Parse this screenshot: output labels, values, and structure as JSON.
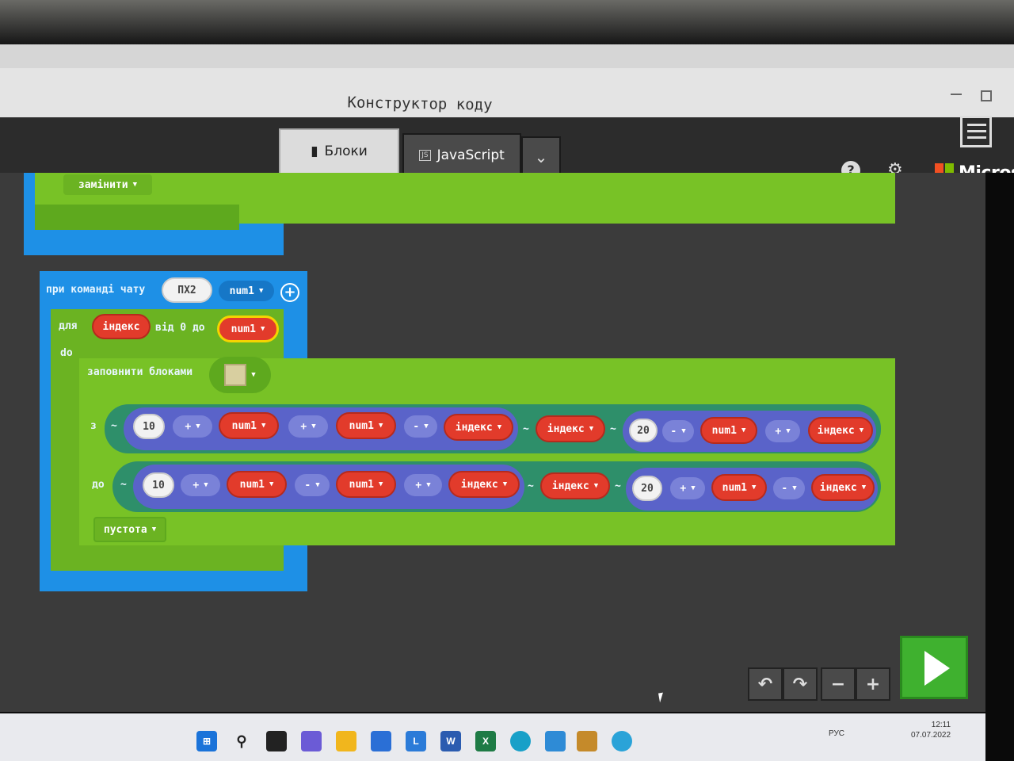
{
  "window": {
    "title": "Конструктор коду"
  },
  "tabs": {
    "blocks_label": "Блоки",
    "js_label": "JavaScript",
    "js_badge": "JS"
  },
  "brand": {
    "name": "Microso"
  },
  "blocks": {
    "top": {
      "replace_label": "замінити"
    },
    "chat": {
      "prefix": "при команді чату",
      "command": "ПХ2",
      "param": "num1"
    },
    "for_loop": {
      "for_label": "для",
      "var": "індекс",
      "range_label": "від 0 до",
      "limit": "num1",
      "do_label": "do"
    },
    "fill": {
      "label": "заповнити блоками",
      "from_label": "з",
      "to_label": "до",
      "mode": "пустота"
    },
    "from_row": {
      "start": "10",
      "op1": "+",
      "v1": "num1",
      "op2": "+",
      "v2": "num1",
      "op3": "-",
      "v3": "індекс",
      "y": "індекс",
      "z_num": "20",
      "zop1": "-",
      "z1": "num1",
      "zop2": "+",
      "z2": "індекс"
    },
    "to_row": {
      "start": "10",
      "op1": "+",
      "v1": "num1",
      "op2": "-",
      "v2": "num1",
      "op3": "+",
      "v3": "індекс",
      "y": "індекс",
      "z_num": "20",
      "zop1": "+",
      "z1": "num1",
      "zop2": "-",
      "z2": "індекс"
    }
  },
  "taskbar": {
    "lang": "РУС",
    "time": "12:11",
    "date": "07.07.2022"
  },
  "colors": {
    "event_blue": "#1e90e6",
    "block_lime": "#78c226",
    "var_red": "#e23b2b",
    "math_violet": "#5a63c9"
  }
}
